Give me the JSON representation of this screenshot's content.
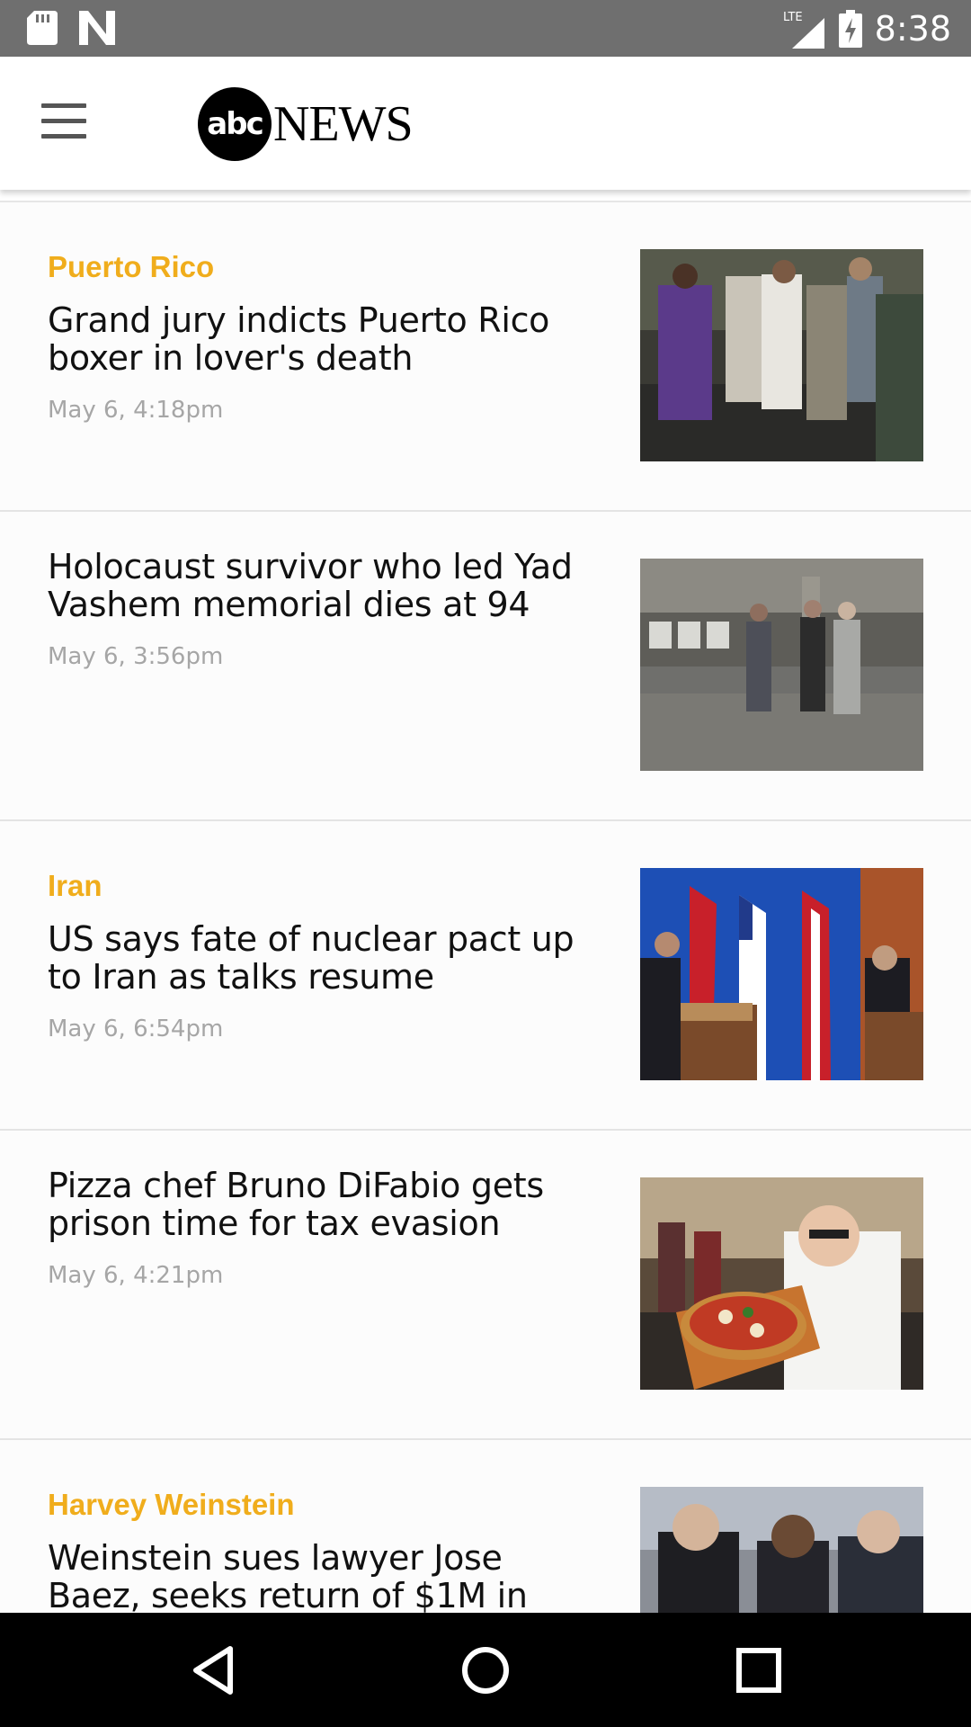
{
  "status_bar": {
    "time": "8:38",
    "network": "LTE",
    "icons": [
      "sd-card-icon",
      "n-notification-icon",
      "lte-signal-icon",
      "battery-charging-icon"
    ]
  },
  "header": {
    "logo_badge": "abc",
    "logo_text": "NEWS",
    "menu_icon": "hamburger-menu-icon"
  },
  "colors": {
    "category": "#f0ad1c",
    "headline": "#111111",
    "date": "#a6a6a6",
    "status_bar": "#6f6f6f"
  },
  "stories": [
    {
      "category": "Puerto Rico",
      "headline": "Grand jury indicts Puerto Rico boxer in lover's death",
      "date": "May 6, 4:18pm"
    },
    {
      "category": "",
      "headline": "Holocaust survivor who led Yad Vashem memorial dies at 94",
      "date": "May 6, 3:56pm"
    },
    {
      "category": "Iran",
      "headline": "US says fate of nuclear pact up to Iran as talks resume",
      "date": "May 6, 6:54pm"
    },
    {
      "category": "",
      "headline": "Pizza chef Bruno DiFabio gets prison time for tax evasion",
      "date": "May 6, 4:21pm"
    },
    {
      "category": "Harvey Weinstein",
      "headline": "Weinstein sues lawyer Jose Baez, seeks return of $1M in",
      "date": ""
    }
  ],
  "nav_bar": {
    "back_icon": "back-triangle-icon",
    "home_icon": "home-circle-icon",
    "recents_icon": "recents-square-icon"
  }
}
